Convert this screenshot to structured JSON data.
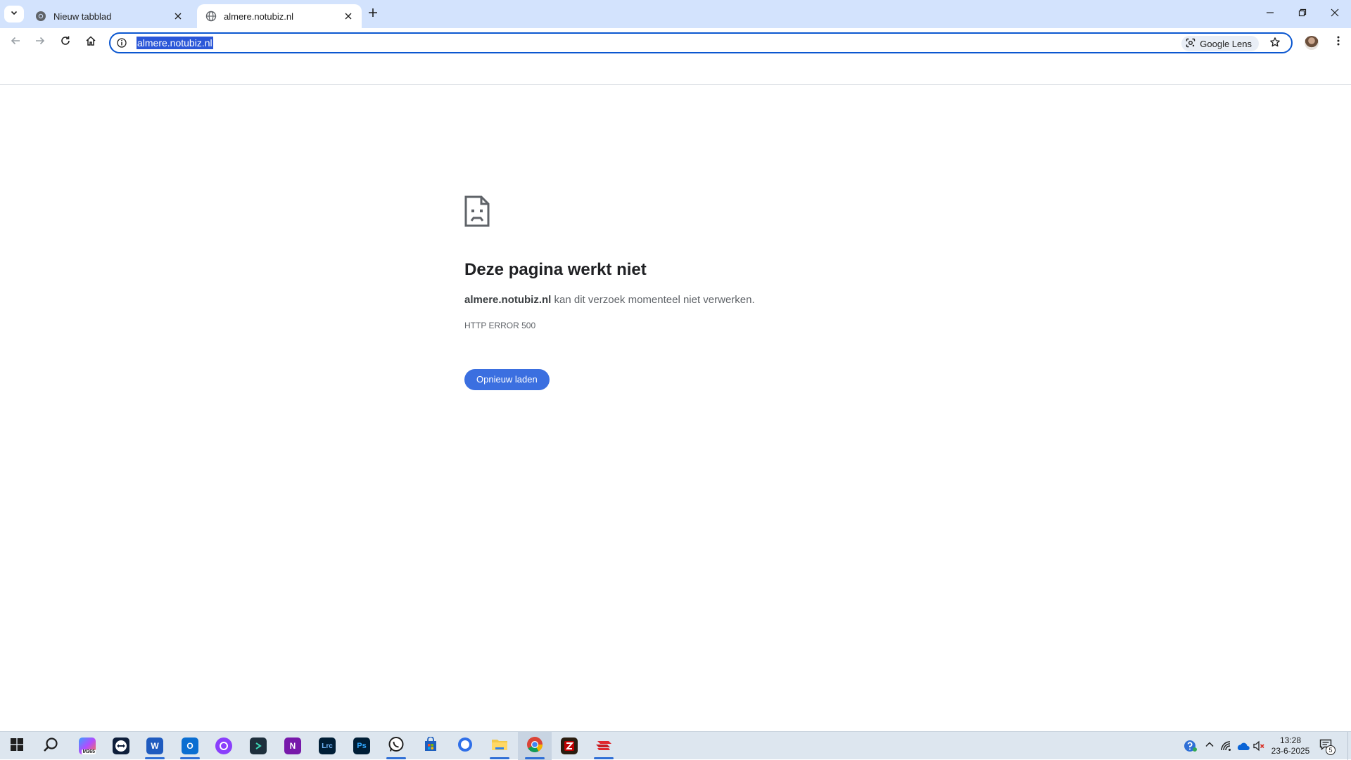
{
  "browser": {
    "tabs": [
      {
        "title": "Nieuw tabblad",
        "active": false,
        "icon": "chrome-icon"
      },
      {
        "title": "almere.notubiz.nl",
        "active": true,
        "icon": "globe-icon"
      }
    ],
    "address_bar": {
      "url": "almere.notubiz.nl",
      "selected": true
    },
    "lens_label": "Google Lens"
  },
  "error_page": {
    "heading": "Deze pagina werkt niet",
    "host": "almere.notubiz.nl",
    "message": " kan dit verzoek momenteel niet verwerken.",
    "code": "HTTP ERROR 500",
    "reload_label": "Opnieuw laden"
  },
  "taskbar": {
    "apps": [
      {
        "name": "start",
        "icon": "windows-start-icon"
      },
      {
        "name": "search",
        "icon": "search-icon"
      },
      {
        "name": "microsoft-365",
        "icon": "m365-icon",
        "label": "M365"
      },
      {
        "name": "teamviewer",
        "icon": "teamviewer-icon"
      },
      {
        "name": "word",
        "icon": "word-icon",
        "label": "W",
        "running": true
      },
      {
        "name": "outlook",
        "icon": "outlook-icon",
        "label": "O",
        "running": true
      },
      {
        "name": "app-purple-circle",
        "icon": "purple-circle-icon"
      },
      {
        "name": "app-dark-arrow",
        "icon": "dark-arrow-icon"
      },
      {
        "name": "onenote",
        "icon": "onenote-icon",
        "label": "N"
      },
      {
        "name": "lightroom-classic",
        "icon": "lightroom-icon",
        "label": "Lrc"
      },
      {
        "name": "photoshop",
        "icon": "photoshop-icon",
        "label": "Ps"
      },
      {
        "name": "whatsapp",
        "icon": "whatsapp-icon",
        "running": true
      },
      {
        "name": "microsoft-store",
        "icon": "store-icon"
      },
      {
        "name": "app-blue-ring",
        "icon": "blue-ring-icon"
      },
      {
        "name": "file-explorer",
        "icon": "folder-icon",
        "running": true
      },
      {
        "name": "chrome",
        "icon": "chrome-icon",
        "active": true
      },
      {
        "name": "filezilla",
        "icon": "filezilla-icon"
      },
      {
        "name": "app-red-stack",
        "icon": "red-stack-icon",
        "running": true
      }
    ],
    "clock": {
      "time": "13:28",
      "date": "23-6-2025"
    },
    "notification_count": "5"
  },
  "colors": {
    "tabstrip_bg": "#d3e3fd",
    "accent": "#0b57d0",
    "reload_button": "#3b6fe0",
    "taskbar_bg": "#dde6ef"
  }
}
